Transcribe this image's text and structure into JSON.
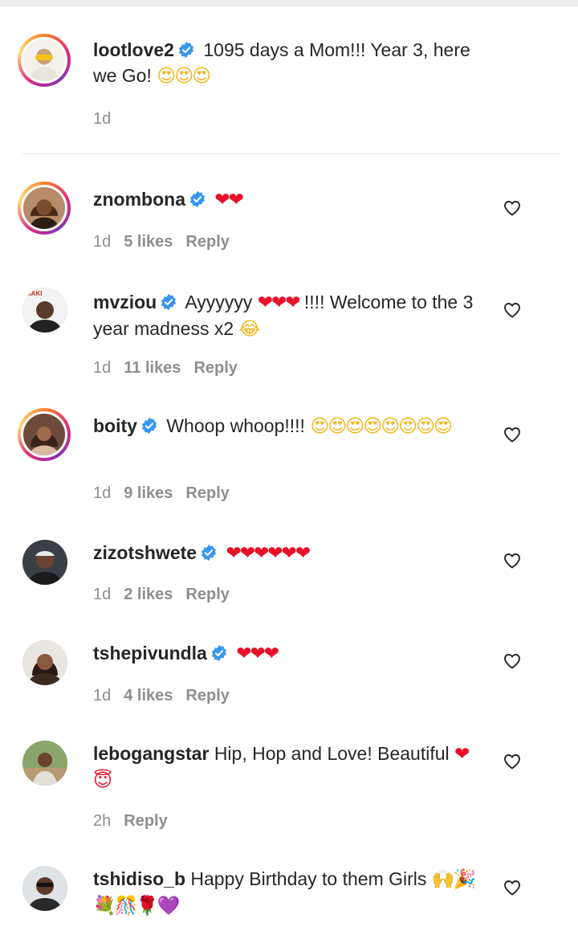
{
  "post_caption": {
    "username": "lootlove2",
    "verified": true,
    "text": "1095 days a Mom!!! Year 3, here we Go!",
    "emoji": "😍😍😍",
    "time": "1d"
  },
  "comments": [
    {
      "username": "znombona",
      "verified": true,
      "text": "",
      "emoji": "❤❤",
      "emoji_kind": "hearts",
      "time": "1d",
      "likes": "5 likes",
      "reply": "Reply"
    },
    {
      "username": "mvziou",
      "verified": true,
      "text": "Ayyyyyy",
      "emoji": "❤❤❤",
      "emoji_kind": "hearts",
      "text_after": "!!!! Welcome to the 3 year madness x2",
      "emoji_after": "😂",
      "time": "1d",
      "likes": "11 likes",
      "reply": "Reply"
    },
    {
      "username": "boity",
      "verified": true,
      "text": "Whoop whoop!!!!",
      "emoji": "😍😍😍😍😍😍😍😍",
      "emoji_kind": "faces",
      "time": "1d",
      "likes": "9 likes",
      "reply": "Reply"
    },
    {
      "username": "zizotshwete",
      "verified": true,
      "text": "",
      "emoji": "❤❤❤❤❤❤",
      "emoji_kind": "hearts",
      "time": "1d",
      "likes": "2 likes",
      "reply": "Reply"
    },
    {
      "username": "tshepivundla",
      "verified": true,
      "text": "",
      "emoji": "❤❤❤",
      "emoji_kind": "hearts",
      "time": "1d",
      "likes": "4 likes",
      "reply": "Reply"
    },
    {
      "username": "lebogangstar",
      "verified": false,
      "text": "Hip, Hop and Love! Beautiful",
      "emoji": "❤😇",
      "emoji_kind": "faces",
      "time": "2h",
      "likes": "",
      "reply": "Reply"
    },
    {
      "username": "tshidiso_b",
      "verified": false,
      "text": "Happy Birthday to them Girls",
      "emoji": "🙌🎉💐🎊🌹💜",
      "emoji_kind": "faces",
      "time": "",
      "likes": "",
      "reply": ""
    }
  ],
  "colors": {
    "text": "#262626",
    "meta": "#8e8e8e",
    "verified_blue": "#3897f0",
    "heart_red": "#e8102a",
    "story_ring": "#dd2a7b"
  },
  "icons": {
    "verified": "verified-badge-icon",
    "like": "heart-outline-icon"
  }
}
